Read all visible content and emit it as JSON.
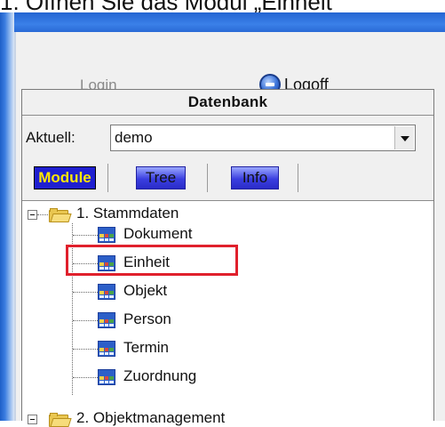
{
  "instruction": "1. Öffnen Sie das Modul „Einheit“",
  "header": {
    "login_label": "Login",
    "logoff_label": "Logoff"
  },
  "database": {
    "title": "Datenbank",
    "aktuell_label": "Aktuell:",
    "aktuell_value": "demo"
  },
  "tabs": [
    {
      "label": "Module",
      "active": true
    },
    {
      "label": "Tree",
      "active": false
    },
    {
      "label": "Info",
      "active": false
    }
  ],
  "tree": {
    "root_label": "1. Stammdaten",
    "items": [
      {
        "label": "Dokument"
      },
      {
        "label": "Einheit",
        "highlighted": true
      },
      {
        "label": "Objekt"
      },
      {
        "label": "Person"
      },
      {
        "label": "Termin"
      },
      {
        "label": "Zuordnung"
      }
    ],
    "next_root_label": "2. Objektmanagement"
  },
  "colors": {
    "highlight": "#e0202c",
    "tab_active_bg": "#1f1fd0",
    "tab_active_text": "#ffe600",
    "frame_blue": "#2465d2"
  }
}
